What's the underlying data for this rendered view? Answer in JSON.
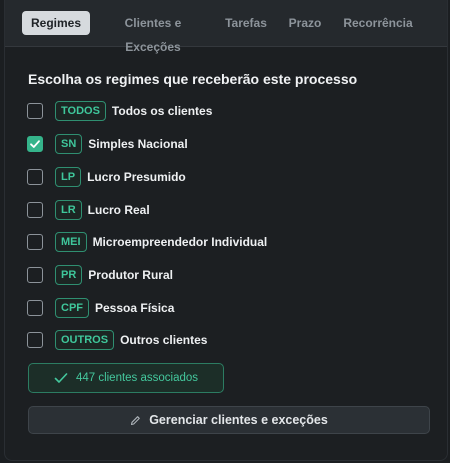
{
  "tabs": [
    {
      "label": "Regimes",
      "active": true
    },
    {
      "label": "Clientes e Exceções",
      "active": false
    },
    {
      "label": "Tarefas",
      "active": false
    },
    {
      "label": "Prazo",
      "active": false
    },
    {
      "label": "Recorrência",
      "active": false
    }
  ],
  "section": {
    "title": "Escolha os regimes que receberão este processo"
  },
  "regimes": [
    {
      "code": "TODOS",
      "label": "Todos os clientes",
      "checked": false
    },
    {
      "code": "SN",
      "label": "Simples Nacional",
      "checked": true
    },
    {
      "code": "LP",
      "label": "Lucro Presumido",
      "checked": false
    },
    {
      "code": "LR",
      "label": "Lucro Real",
      "checked": false
    },
    {
      "code": "MEI",
      "label": "Microempreendedor Individual",
      "checked": false
    },
    {
      "code": "PR",
      "label": "Produtor Rural",
      "checked": false
    },
    {
      "code": "CPF",
      "label": "Pessoa Física",
      "checked": false
    },
    {
      "code": "OUTROS",
      "label": "Outros clientes",
      "checked": false
    }
  ],
  "summary": {
    "associated_text": "447 clientes associados",
    "icon": "check-icon"
  },
  "actions": {
    "manage_label": "Gerenciar clientes e exceções",
    "manage_icon": "pencil-icon"
  },
  "colors": {
    "accent": "#35b48b",
    "background": "#1c1f22",
    "tab_active_bg": "#d6dade"
  }
}
